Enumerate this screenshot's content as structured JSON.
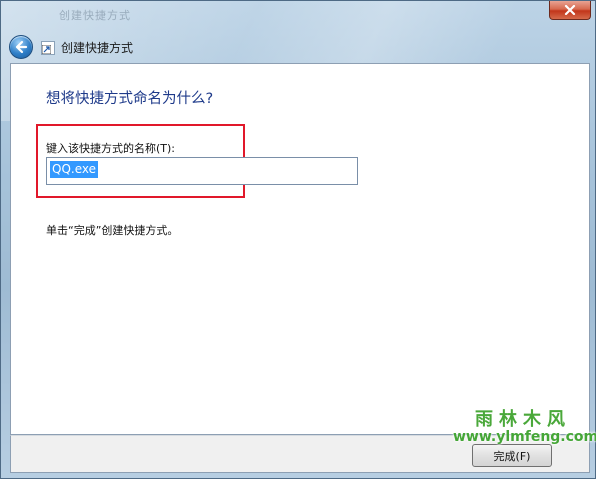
{
  "window": {
    "title_faint": "创建快捷方式",
    "close_symbol": "×"
  },
  "header": {
    "title": "创建快捷方式",
    "back_icon": "back-arrow-icon",
    "shortcut_icon": "shortcut-icon"
  },
  "main": {
    "question": "想将快捷方式命名为什么?",
    "field_label": "键入该快捷方式的名称(T):",
    "name_value": "QQ.exe",
    "instruction": "单击“完成”创建快捷方式。"
  },
  "footer": {
    "finish_label": "完成(F)"
  },
  "watermark": {
    "brand": "雨林木风",
    "url": "www.ylmfeng.com"
  },
  "colors": {
    "accent_blue": "#1e3a8a",
    "highlight_red": "#e1182a",
    "selection_blue": "#3399ff",
    "watermark_green": "#4aa83a"
  }
}
